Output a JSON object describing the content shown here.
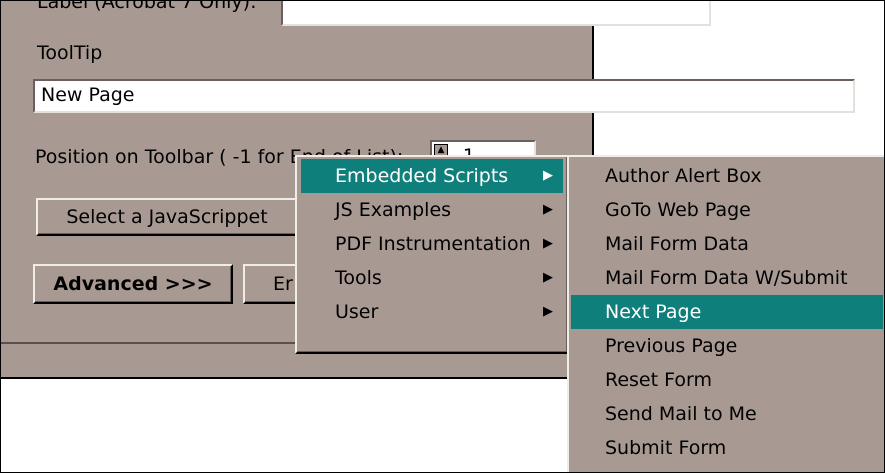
{
  "dialog": {
    "label_caption": "Label (Acrobat 7 Only):",
    "label_value": "",
    "tooltip_caption": "ToolTip",
    "tooltip_value": "New Page",
    "position_caption": "Position on Toolbar ( -1 for End of List):",
    "position_value": "-1",
    "select_script_button": "Select a JavaScrippet",
    "advanced_button": "Advanced >>>",
    "partial_button": "Er"
  },
  "context_menu": {
    "items": [
      {
        "label": "Embedded Scripts",
        "has_submenu": true,
        "highlighted": true
      },
      {
        "label": "JS Examples",
        "has_submenu": true,
        "highlighted": false
      },
      {
        "label": "PDF Instrumentation",
        "has_submenu": true,
        "highlighted": false
      },
      {
        "label": "Tools",
        "has_submenu": true,
        "highlighted": false
      },
      {
        "label": "User",
        "has_submenu": true,
        "highlighted": false
      }
    ]
  },
  "submenu": {
    "items": [
      {
        "label": "Author Alert Box",
        "highlighted": false
      },
      {
        "label": "GoTo Web Page",
        "highlighted": false
      },
      {
        "label": "Mail Form Data",
        "highlighted": false
      },
      {
        "label": "Mail Form Data W/Submit",
        "highlighted": false
      },
      {
        "label": "Next Page",
        "highlighted": true
      },
      {
        "label": "Previous Page",
        "highlighted": false
      },
      {
        "label": "Reset Form",
        "highlighted": false
      },
      {
        "label": "Send Mail to Me",
        "highlighted": false
      },
      {
        "label": "Submit Form",
        "highlighted": false
      }
    ]
  },
  "colors": {
    "dialog_bg": "#a89a92",
    "highlight": "#0f7f7b"
  }
}
